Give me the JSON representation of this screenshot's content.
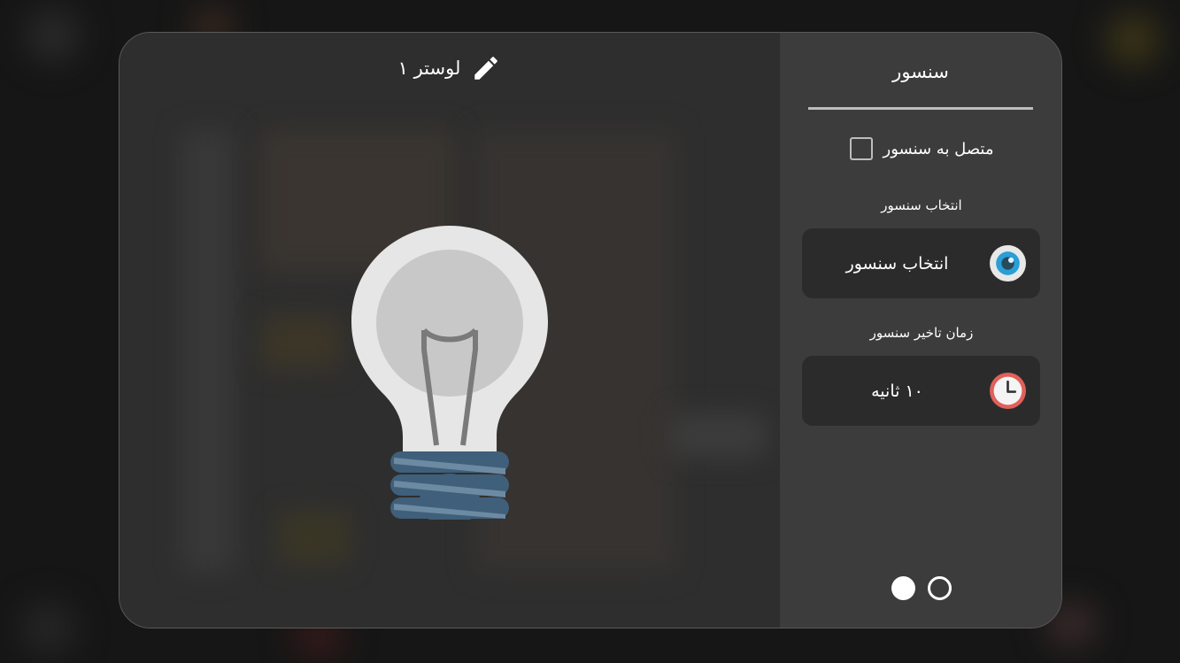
{
  "dialog": {
    "device_title": "لوستر ۱",
    "edit_icon": "pencil-icon",
    "device_icon": "light-bulb-icon"
  },
  "sensor_panel": {
    "tab_title": "سنسور",
    "connect_checkbox": {
      "label": "متصل به سنسور",
      "checked": false
    },
    "select_section": {
      "label": "انتخاب سنسور",
      "button_label": "انتخاب سنسور",
      "icon": "eye-icon"
    },
    "delay_section": {
      "label": "زمان تاخیر سنسور",
      "value": "۱۰ ثانیه",
      "icon": "clock-icon"
    },
    "pager": {
      "pages": 2,
      "active": 1
    }
  },
  "colors": {
    "accent_eye": "#2a9fd6",
    "accent_clock": "#e0605a",
    "bulb_glass": "#e6e6e6",
    "bulb_base": "#3f5f7a"
  }
}
